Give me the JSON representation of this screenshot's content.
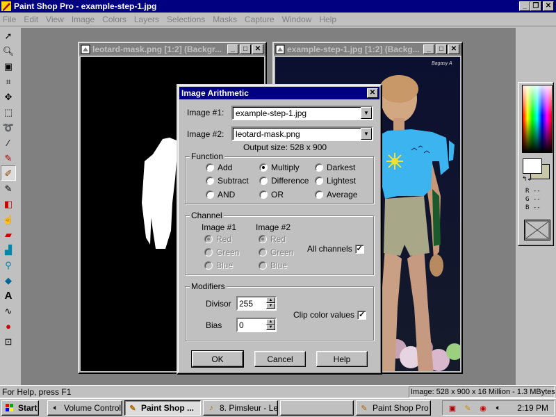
{
  "app": {
    "title": "Paint Shop Pro - example-step-1.jpg",
    "minimize": "_",
    "restore": "❐",
    "close": "✕"
  },
  "menu": {
    "items": [
      "File",
      "Edit",
      "View",
      "Image",
      "Colors",
      "Layers",
      "Selections",
      "Masks",
      "Capture",
      "Window",
      "Help"
    ]
  },
  "tools": [
    "arrow-icon",
    "zoom-icon",
    "deformation-icon",
    "crop-icon",
    "mover-icon",
    "selection-icon",
    "freehand-icon",
    "magic-wand-icon",
    "dropper-icon",
    "paintbrush-icon",
    "clone-brush-icon",
    "color-replacer-icon",
    "retouch-icon",
    "eraser-icon",
    "picture-tube-icon",
    "airbrush-icon",
    "flood-fill-icon",
    "text-icon",
    "draw-icon",
    "shapes-icon",
    "vector-object-icon"
  ],
  "documents": {
    "left": {
      "title": "leotard-mask.png [1:2] (Backgr..."
    },
    "right": {
      "title": "example-step-1.jpg [1:2] (Backg...",
      "watermark": "Bagasy A"
    }
  },
  "palette": {
    "rgb": [
      "R --",
      "G --",
      "B --"
    ]
  },
  "dialog": {
    "title": "Image Arithmetic",
    "image1_label": "Image #1:",
    "image1_value": "example-step-1.jpg",
    "image2_label": "Image #2:",
    "image2_value": "leotard-mask.png",
    "output_size": "Output size: 528 x 900",
    "function": {
      "title": "Function",
      "options": [
        "Add",
        "Multiply",
        "Darkest",
        "Subtract",
        "Difference",
        "Lightest",
        "AND",
        "OR",
        "Average"
      ],
      "selected": "Multiply"
    },
    "channel": {
      "title": "Channel",
      "image1_header": "Image #1",
      "image2_header": "Image #2",
      "channels": [
        "Red",
        "Green",
        "Blue"
      ],
      "all_channels_label": "All channels",
      "all_channels_checked": true
    },
    "modifiers": {
      "title": "Modifiers",
      "divisor_label": "Divisor",
      "divisor_value": "255",
      "bias_label": "Bias",
      "bias_value": "0",
      "clip_label": "Clip color values",
      "clip_checked": true
    },
    "buttons": {
      "ok": "OK",
      "cancel": "Cancel",
      "help": "Help"
    }
  },
  "status": {
    "help": "For Help, press F1",
    "info": "Image:  528 x 900 x 16 Million - 1.3 MBytes"
  },
  "taskbar": {
    "start": "Start",
    "tasks": [
      "Volume Control",
      "Paint Shop ...",
      "8. Pimsleur - Le...",
      "",
      "Paint Shop Pro"
    ],
    "clock": "2:19 PM"
  }
}
